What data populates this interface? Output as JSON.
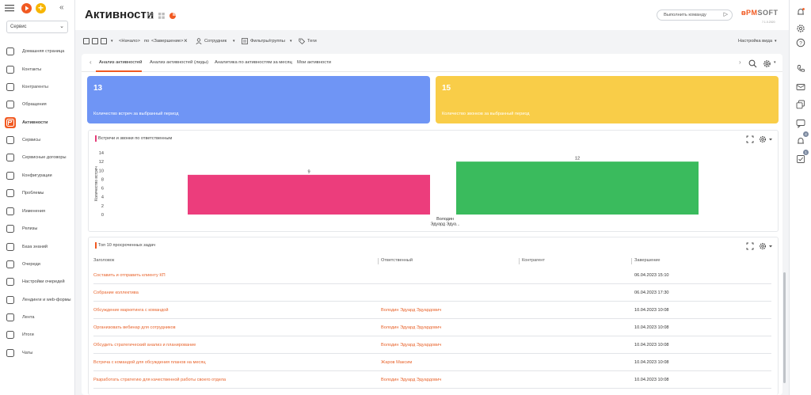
{
  "sidebar": {
    "section_select": "Сервис",
    "items": [
      {
        "label": "Домашняя страница",
        "icon": "home-icon"
      },
      {
        "label": "Контакты",
        "icon": "contacts-icon"
      },
      {
        "label": "Контрагенты",
        "icon": "accounts-icon"
      },
      {
        "label": "Обращения",
        "icon": "cases-icon"
      },
      {
        "label": "Активности",
        "icon": "activities-icon",
        "active": true
      },
      {
        "label": "Сервисы",
        "icon": "services-icon"
      },
      {
        "label": "Сервисные договоры",
        "icon": "service-contracts-icon"
      },
      {
        "label": "Конфигурации",
        "icon": "configurations-icon"
      },
      {
        "label": "Проблемы",
        "icon": "problems-icon"
      },
      {
        "label": "Изменения",
        "icon": "changes-icon"
      },
      {
        "label": "Релизы",
        "icon": "releases-icon"
      },
      {
        "label": "База знаний",
        "icon": "knowledge-base-icon"
      },
      {
        "label": "Очереди",
        "icon": "queues-icon"
      },
      {
        "label": "Настройки очередей",
        "icon": "queue-settings-icon"
      },
      {
        "label": "Лендинги и web-формы",
        "icon": "landings-icon"
      },
      {
        "label": "Лента",
        "icon": "feed-icon"
      },
      {
        "label": "Итоги",
        "icon": "dashboards-icon"
      },
      {
        "label": "Чаты",
        "icon": "chats-icon"
      }
    ]
  },
  "header": {
    "title": "Активности",
    "command_placeholder": "Выполнить команду",
    "logo_main": "ᴃPM",
    "logo_soft": "SOFT",
    "logo_sub": "7.1.0.2020"
  },
  "filters": {
    "start": "<Начало>",
    "by": "по",
    "end": "<Завершение>",
    "employee": "Сотрудник",
    "filters_groups": "Фильтры/группы",
    "tags": "Теги",
    "view_settings": "Настройка вида"
  },
  "tabs": [
    {
      "label": "Анализ активностей",
      "active": true
    },
    {
      "label": "Анализ активностей (лиды)"
    },
    {
      "label": "Аналитика по активностям за месяц"
    },
    {
      "label": "Мои активности"
    }
  ],
  "kpis": [
    {
      "value": "13",
      "caption": "Количество встреч за выбранный период",
      "color": "#6f95f5"
    },
    {
      "value": "15",
      "caption": "Количество звонков за выбранный период",
      "color": "#f9cd48"
    }
  ],
  "chart_panel": {
    "title": "Встречи и звонки по ответственным",
    "accent": "#e63e79",
    "ylabel": "Количество встреч",
    "x_label_line1": "Володин",
    "x_label_line2": "Эдуард Эдуа..."
  },
  "chart_data": {
    "type": "bar",
    "title": "Встречи и звонки по ответственным",
    "ylabel": "Количество встреч",
    "xlabel": "",
    "categories": [
      "Володин Эдуард Эдуа..."
    ],
    "series": [
      {
        "values": [
          9
        ],
        "color": "#ec3d7c"
      },
      {
        "values": [
          12
        ],
        "color": "#3abb5d"
      }
    ],
    "ylim": [
      0,
      14
    ],
    "yticks": [
      0,
      2,
      4,
      6,
      8,
      10,
      12,
      14
    ],
    "data_labels": true,
    "grid": false
  },
  "table_panel": {
    "title": "Топ 10 просроченных задач",
    "accent": "#f15a22",
    "columns": [
      "Заголовок",
      "Ответственный",
      "Контрагент",
      "Завершение"
    ],
    "rows": [
      {
        "title": "Составить и отправить клиенту КП",
        "owner": "",
        "account": "",
        "due": "06.04.2023 15:10"
      },
      {
        "title": "Собрание коллектива",
        "owner": "",
        "account": "",
        "due": "06.04.2023 17:30"
      },
      {
        "title": "Обсуждение маркетинга с командой",
        "owner": "Володин Эдуард Эдуардович",
        "account": "",
        "due": "10.04.2023 10:08"
      },
      {
        "title": "Организовать вебинар для сотрудников",
        "owner": "Володин Эдуард Эдуардович",
        "account": "",
        "due": "10.04.2023 10:08"
      },
      {
        "title": "Обсудить стратегический анализ и планирование",
        "owner": "Володин Эдуард Эдуардович",
        "account": "",
        "due": "10.04.2023 10:08"
      },
      {
        "title": "Встреча с командой для обсуждения планов на месяц",
        "owner": "Жаров Максим",
        "account": "",
        "due": "10.04.2023 10:08"
      },
      {
        "title": "Разработать стратегию для качественной работы своего отдела",
        "owner": "Володин Эдуард Эдуардович",
        "account": "",
        "due": "10.04.2023 10:08"
      }
    ]
  },
  "rightbar": {
    "badge_feed": "4",
    "badge_tasks": "1"
  }
}
